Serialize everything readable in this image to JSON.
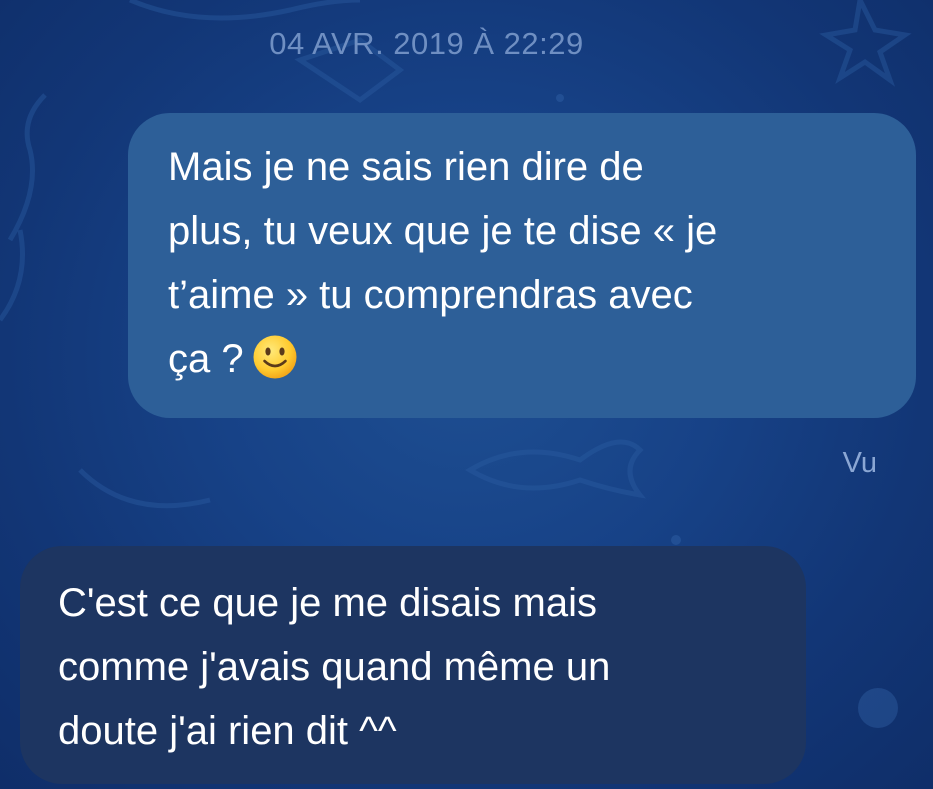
{
  "thread": {
    "timestamp": "04 AVR. 2019 À 22:29",
    "read_receipt": "Vu"
  },
  "messages": [
    {
      "direction": "outgoing",
      "lines": [
        "Mais je ne sais rien dire de",
        "plus, tu veux que je te dise « je",
        "t’aime » tu comprendras avec",
        "ça ?"
      ],
      "emoji": "slightly-smiling-face-icon"
    },
    {
      "direction": "incoming",
      "lines": [
        "C'est ce que je me disais mais",
        "comme j'avais quand même un",
        "doute j'ai rien dit ^^"
      ]
    }
  ],
  "colors": {
    "background": "#174287",
    "outgoing_bubble": "#2d5f98",
    "incoming_bubble": "#1d3561",
    "timestamp_text": "#6f8fc2",
    "receipt_text": "#8ba7d4"
  }
}
